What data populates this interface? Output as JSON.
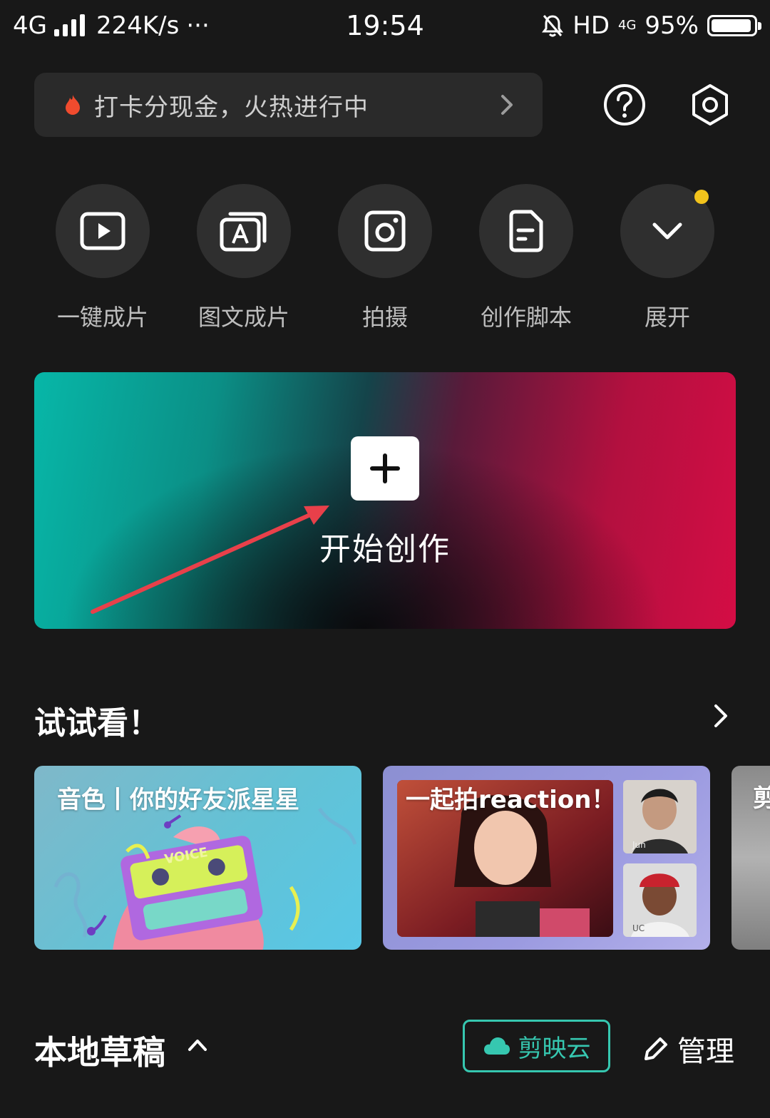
{
  "status_bar": {
    "network": "4G",
    "speed": "224K/s",
    "more": "···",
    "time": "19:54",
    "hd": "HD",
    "network_small": "4G",
    "battery": "95%",
    "battery_level": 0.95
  },
  "promo": {
    "text": "打卡分现金，火热进行中"
  },
  "shortcuts": [
    {
      "label": "一键成片",
      "icon": "play-video-icon"
    },
    {
      "label": "图文成片",
      "icon": "text-to-video-icon"
    },
    {
      "label": "拍摄",
      "icon": "camera-icon"
    },
    {
      "label": "创作脚本",
      "icon": "script-doc-icon"
    },
    {
      "label": "展开",
      "icon": "chevron-down-icon"
    }
  ],
  "hero": {
    "title": "开始创作"
  },
  "try_section": {
    "title": "试试看！"
  },
  "cards": [
    {
      "title": "音色丨你的好友派星星",
      "art_text": "VOICE"
    },
    {
      "title": "一起拍reaction！",
      "name1": "Jun",
      "name2": "UC"
    },
    {
      "title": "剪"
    }
  ],
  "drafts": {
    "title": "本地草稿",
    "cloud_label": "剪映云",
    "manage_label": "管理"
  },
  "colors": {
    "background": "#181818",
    "accent": "#36c7b0",
    "dot": "#f2c31c"
  }
}
